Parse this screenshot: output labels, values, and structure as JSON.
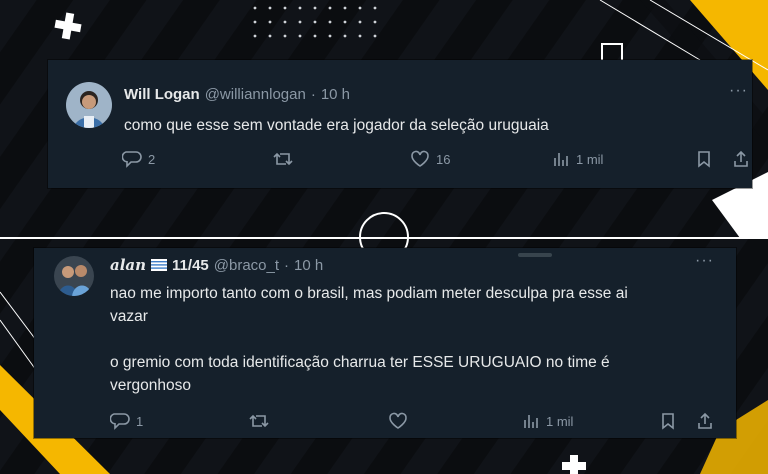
{
  "tweets": [
    {
      "display_name": "Will Logan",
      "handle": "@williannlogan",
      "separator": "·",
      "time": "10 h",
      "text_lines": [
        "como que esse sem vontade era jogador da seleção uruguaia"
      ],
      "more_label": "···",
      "replies": "2",
      "retweets": "",
      "likes": "16",
      "views": "1 mil"
    },
    {
      "display_name": "alan",
      "name_suffix": "11/45",
      "handle": "@braco_t",
      "separator": "·",
      "time": "10 h",
      "text_lines": [
        "nao me importo tanto com o brasil, mas podiam meter desculpa pra esse ai",
        "vazar",
        "",
        "o gremio com toda identificação charrua ter ESSE URUGUAIO no time é",
        "vergonhoso"
      ],
      "more_label": "···",
      "replies": "1",
      "retweets": "",
      "likes": "",
      "views": "1 mil"
    }
  ],
  "colors": {
    "card_bg": "#15202b",
    "text": "#e7e9ea",
    "muted": "#8b98a5",
    "accent_yellow": "#f5b700"
  }
}
